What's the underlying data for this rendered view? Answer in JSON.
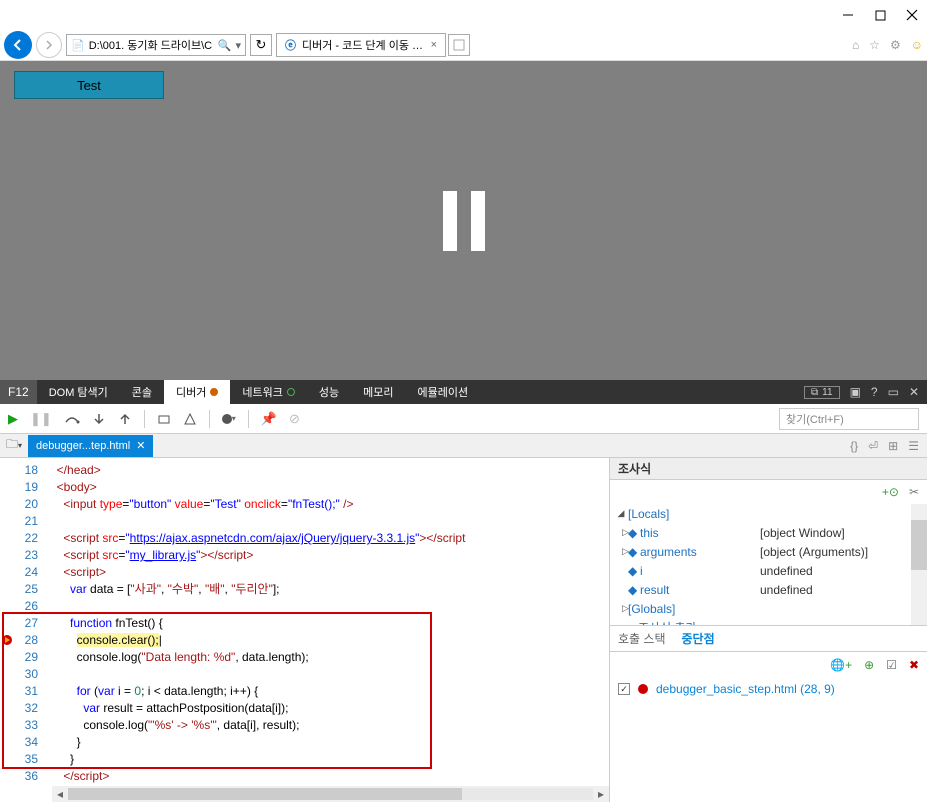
{
  "window": {
    "address": "D:\\001. 동기화 드라이브\\C",
    "tab_title": "디버거 - 코드 단계 이동 기...",
    "test_button": "Test"
  },
  "devtools": {
    "f12": "F12",
    "tabs": {
      "dom": "DOM 탐색기",
      "console": "콘솔",
      "debugger": "디버거",
      "network": "네트워크",
      "perf": "성능",
      "memory": "메모리",
      "emulation": "에뮬레이션"
    },
    "error_count": "11",
    "find_placeholder": "찾기(Ctrl+F)",
    "doc_tab": "debugger...tep.html"
  },
  "code": {
    "lines": [
      {
        "n": 18,
        "html": "  <span class='tag'>&lt;/head&gt;</span>"
      },
      {
        "n": 19,
        "html": "  <span class='tag'>&lt;body&gt;</span>"
      },
      {
        "n": 20,
        "html": "    <span class='tag'>&lt;input</span> <span class='attr'>type</span>=<span class='kw'>\"button\"</span> <span class='attr'>value</span>=<span class='kw'>\"Test\"</span> <span class='attr'>onclick</span>=<span class='kw'>\"fnTest();\"</span> <span class='tag'>/&gt;</span>"
      },
      {
        "n": 21,
        "html": ""
      },
      {
        "n": 22,
        "html": "    <span class='tag'>&lt;script</span> <span class='attr'>src</span>=<span class='kw'>\"</span><span class='url'>https://ajax.aspnetcdn.com/ajax/jQuery/jquery-3.3.1.js</span><span class='kw'>\"</span><span class='tag'>&gt;&lt;/script</span>"
      },
      {
        "n": 23,
        "html": "    <span class='tag'>&lt;script</span> <span class='attr'>src</span>=<span class='kw'>\"</span><span class='url'>my_library.js</span><span class='kw'>\"</span><span class='tag'>&gt;&lt;/script&gt;</span>"
      },
      {
        "n": 24,
        "html": "    <span class='tag'>&lt;script&gt;</span>"
      },
      {
        "n": 25,
        "html": "      <span class='kw'>var</span> data = [<span class='str'>\"사과\"</span>, <span class='str'>\"수박\"</span>, <span class='str'>\"배\"</span>, <span class='str'>\"두리안\"</span>];"
      },
      {
        "n": 26,
        "html": ""
      },
      {
        "n": 27,
        "html": "      <span class='kw'>function</span> fnTest() {"
      },
      {
        "n": 28,
        "html": "        <span class='hl'>console.clear();</span>|"
      },
      {
        "n": 29,
        "html": "        console.log(<span class='str'>\"Data length: %d\"</span>, data.length);"
      },
      {
        "n": 30,
        "html": ""
      },
      {
        "n": 31,
        "html": "        <span class='kw'>for</span> (<span class='kw'>var</span> i = <span class='num'>0</span>; i &lt; data.length; i++) {"
      },
      {
        "n": 32,
        "html": "          <span class='kw'>var</span> result = attachPostposition(data[i]);"
      },
      {
        "n": 33,
        "html": "          console.log(<span class='str'>\"'%s' -&gt; '%s'\"</span>, data[i], result);"
      },
      {
        "n": 34,
        "html": "        }"
      },
      {
        "n": 35,
        "html": "      }"
      },
      {
        "n": 36,
        "html": "    <span class='tag'>&lt;/script&gt;</span>"
      }
    ],
    "highlight_line": 28,
    "red_box": {
      "top_line": 27,
      "bottom_line": 35
    }
  },
  "watch": {
    "title": "조사식",
    "locals": "[Locals]",
    "rows": [
      {
        "caret": "▷",
        "name": "this",
        "value": "[object Window]"
      },
      {
        "caret": "▷",
        "name": "arguments",
        "value": "[object (Arguments)]"
      },
      {
        "caret": "",
        "name": "i",
        "value": "undefined"
      },
      {
        "caret": "",
        "name": "result",
        "value": "undefined"
      }
    ],
    "globals": "[Globals]",
    "add": "조사식 추가"
  },
  "stack": {
    "tab_callstack": "호출 스택",
    "tab_breakpoints": "중단점"
  },
  "breakpoints": {
    "items": [
      {
        "checked": true,
        "label": "debugger_basic_step.html (28, 9)"
      }
    ]
  }
}
